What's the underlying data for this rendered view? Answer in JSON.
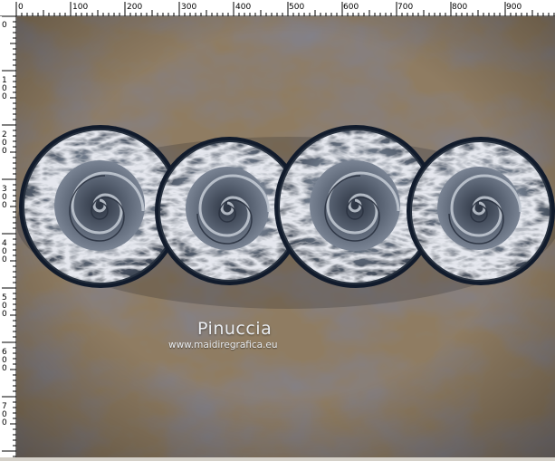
{
  "ruler": {
    "top_labels": [
      "0",
      "100",
      "200",
      "300",
      "400",
      "500",
      "600",
      "700",
      "800",
      "900"
    ],
    "left_labels": [
      [
        "0"
      ],
      [
        "1",
        "0",
        "0"
      ],
      [
        "2",
        "0",
        "0"
      ],
      [
        "3",
        "0",
        "0"
      ],
      [
        "4",
        "0",
        "0"
      ],
      [
        "5",
        "0",
        "0"
      ],
      [
        "6",
        "0",
        "0"
      ],
      [
        "7",
        "0",
        "0"
      ]
    ]
  },
  "canvas": {
    "watermark_title": "Pinuccia",
    "watermark_url": "www.maidiregrafica.eu",
    "circle_count": 4
  },
  "colors": {
    "background_tan": "#8f7c62",
    "background_dark": "#2e3037",
    "metal_light": "#c6ccd6",
    "metal_dark": "#3b4452",
    "ring_dark": "#111b2c"
  }
}
